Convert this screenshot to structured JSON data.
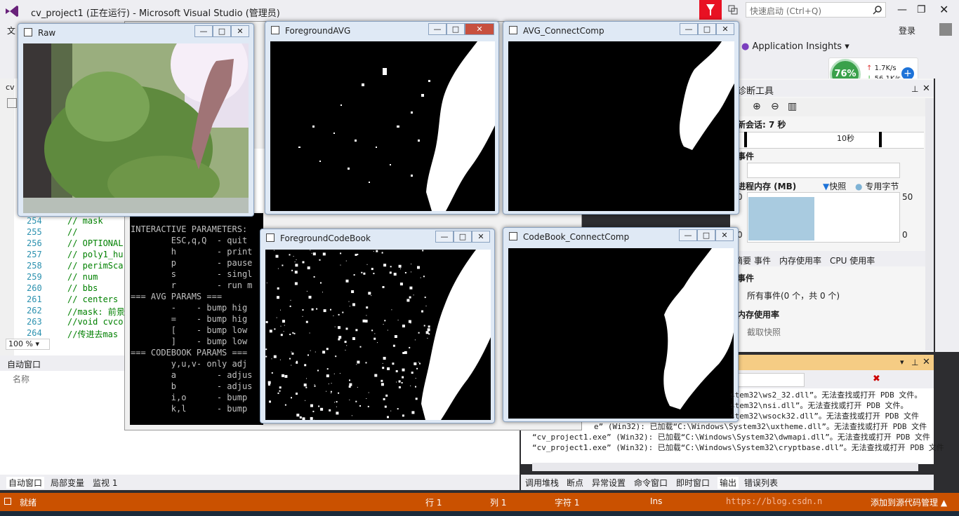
{
  "vs": {
    "title": "cv_project1 (正在运行) - Microsoft Visual Studio (管理员)",
    "quick_launch_placeholder": "快速启动 (Ctrl+Q)",
    "menu_file": "文",
    "login": "登录",
    "app_insights": "Application Insights",
    "window_min": "—",
    "window_max": "❐",
    "window_close": "✕"
  },
  "net_widget": {
    "cpu_percent": "76%",
    "upload": "1.7K/s",
    "download": "56.1K/s",
    "plus": "+"
  },
  "editor": {
    "zoom": "100 %",
    "lines": [
      {
        "num": "254",
        "code": "// mask"
      },
      {
        "num": "255",
        "code": "//"
      },
      {
        "num": "256",
        "code": "// OPTIONAL"
      },
      {
        "num": "257",
        "code": "// poly1_hu"
      },
      {
        "num": "258",
        "code": "// perimSca"
      },
      {
        "num": "259",
        "code": "// num"
      },
      {
        "num": "260",
        "code": "// bbs"
      },
      {
        "num": "261",
        "code": "// centers"
      },
      {
        "num": "262",
        "code": "//mask: 前景"
      },
      {
        "num": "263",
        "code": "//void cvco"
      },
      {
        "num": "264",
        "code": "//传进去mas"
      }
    ]
  },
  "autos": {
    "title": "自动窗口",
    "col_name": "名称",
    "tabs": [
      "自动窗口",
      "局部变量",
      "监视 1"
    ]
  },
  "diag": {
    "title": "诊断工具",
    "session": "新会话: 7 秒",
    "ten_sec": "10秒",
    "events": "事件",
    "process_mem": "进程内存 (MB)",
    "snapshot": "快照",
    "private_bytes": "专用字节",
    "axis_top_left": "0",
    "axis_top_right": "50",
    "axis_bottom_left": "0",
    "axis_bottom_right": "0",
    "tabs": [
      "摘要",
      "事件",
      "内存使用率",
      "CPU 使用率"
    ],
    "events_section": "事件",
    "all_events": "所有事件(0 个，共 0 个)",
    "mem_usage": "内存使用率",
    "take_snapshot": "截取快照"
  },
  "output": {
    "lines": [
      "stem32\\ws2_32.dll”。无法查找或打开 PDB 文件。",
      "stem32\\nsi.dll”。无法查找或打开 PDB 文件。",
      "stem32\\wsock32.dll”。无法查找或打开 PDB 文件",
      "e” (Win32): 已加载“C:\\Windows\\System32\\uxtheme.dll”。无法查找或打开 PDB 文件",
      "“cv_project1.exe” (Win32): 已加载“C:\\Windows\\System32\\dwmapi.dll”。无法查找或打开 PDB 文件",
      "“cv_project1.exe” (Win32): 已加载“C:\\Windows\\System32\\cryptbase.dll”。无法查找或打开 PDB 文件"
    ],
    "tabs": [
      "调用堆栈",
      "断点",
      "异常设置",
      "命令窗口",
      "即时窗口",
      "输出",
      "错误列表"
    ]
  },
  "status": {
    "state": "就绪",
    "row": "行 1",
    "col": "列 1",
    "char": "字符 1",
    "ins": "Ins",
    "watermark": "https://blog.csdn.n",
    "source_control": "添加到源代码管理 ▲"
  },
  "console": {
    "header": "INTERACTIVE PARAMETERS:",
    "lines": [
      "        ESC,q,Q  - quit",
      "        h        - print",
      "        p        - pause",
      "        s        - singl",
      "        r        - run m",
      "=== AVG PARAMS ===",
      "        -    - bump hig",
      "        =    - bump hig",
      "        [    - bump low",
      "        ]    - bump low",
      "=== CODEBOOK PARAMS ===",
      "        y,u,v- only adj",
      "        a        - adjus",
      "        b        - adjus",
      "        i,o      - bump",
      "        k,l      - bump"
    ]
  },
  "cv_windows": {
    "raw": "Raw",
    "fg_avg": "ForegroundAVG",
    "avg_cc": "AVG_ConnectComp",
    "fg_cb": "ForegroundCodeBook",
    "cb_cc": "CodeBook_ConnectComp",
    "btn_min": "—",
    "btn_max": "□",
    "btn_close": "✕"
  }
}
